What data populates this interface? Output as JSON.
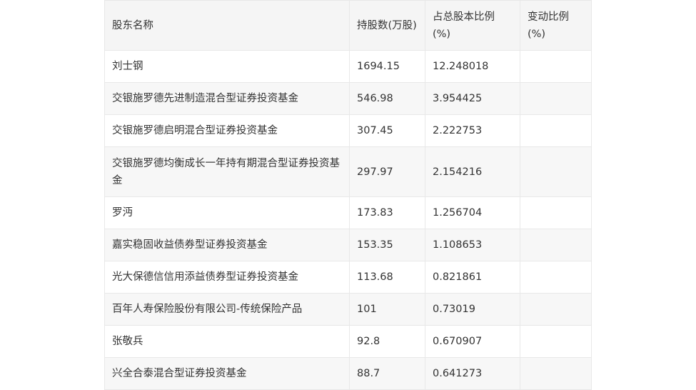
{
  "table": {
    "headers": [
      "股东名称",
      "持股数(万股)",
      "占总股本比例(%)",
      "变动比例(%)"
    ],
    "rows": [
      [
        "刘士钢",
        "1694.15",
        "12.248018",
        ""
      ],
      [
        "交银施罗德先进制造混合型证券投资基金",
        "546.98",
        "3.954425",
        ""
      ],
      [
        "交银施罗德启明混合型证券投资基金",
        "307.45",
        "2.222753",
        ""
      ],
      [
        "交银施罗德均衡成长一年持有期混合型证券投资基金",
        "297.97",
        "2.154216",
        ""
      ],
      [
        "罗沔",
        "173.83",
        "1.256704",
        ""
      ],
      [
        "嘉实稳固收益债券型证券投资基金",
        "153.35",
        "1.108653",
        ""
      ],
      [
        "光大保德信信用添益债券型证券投资基金",
        "113.68",
        "0.821861",
        ""
      ],
      [
        "百年人寿保险股份有限公司-传统保险产品",
        "101",
        "0.73019",
        ""
      ],
      [
        "张敬兵",
        "92.8",
        "0.670907",
        ""
      ],
      [
        "兴全合泰混合型证券投资基金",
        "88.7",
        "0.641273",
        ""
      ]
    ]
  }
}
